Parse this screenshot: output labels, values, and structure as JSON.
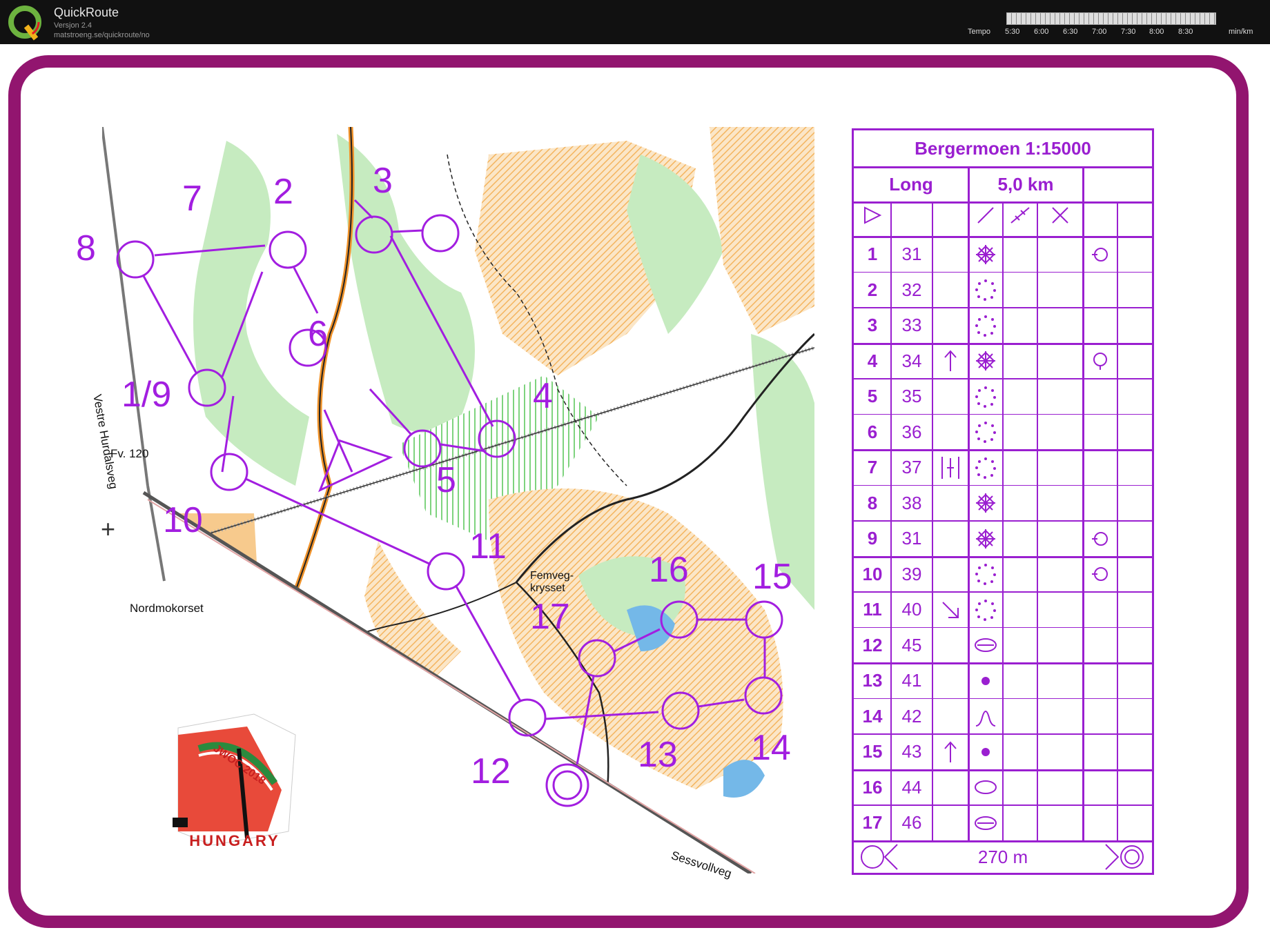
{
  "app": {
    "title": "QuickRoute",
    "version": "Versjon 2.4",
    "url": "matstroeng.se/quickroute/no"
  },
  "legend": {
    "label": "Tempo",
    "ticks": [
      "5:30",
      "6:00",
      "6:30",
      "7:00",
      "7:30",
      "8:00",
      "8:30"
    ],
    "unit": "min/km"
  },
  "map": {
    "place_labels": {
      "road1": "Vestre Hurdalsveg",
      "road2": "Fv. 120",
      "crossing": "Nordmokorset",
      "junction": "Femveg-\nkrysset",
      "road3": "Sessvollveg"
    },
    "control_labels": [
      "8",
      "7",
      "2",
      "3",
      "6",
      "1/9",
      "4",
      "5",
      "10",
      "11",
      "16",
      "15",
      "17",
      "12",
      "13",
      "14"
    ],
    "accent_color": "#a21ee0"
  },
  "description": {
    "title": "Bergermoen 1:15000",
    "class": "Long",
    "length": "5,0 km",
    "rows": [
      {
        "num": "1",
        "code": "31",
        "dir": "",
        "feature": "*",
        "extra": "o"
      },
      {
        "num": "2",
        "code": "32",
        "dir": "",
        "feature": ".",
        "extra": ""
      },
      {
        "num": "3",
        "code": "33",
        "dir": "",
        "feature": ".",
        "extra": ""
      },
      {
        "num": "4",
        "code": "34",
        "dir": "↑",
        "feature": "*",
        "extra": "o"
      },
      {
        "num": "5",
        "code": "35",
        "dir": "",
        "feature": ".",
        "extra": ""
      },
      {
        "num": "6",
        "code": "36",
        "dir": "",
        "feature": ".",
        "extra": ""
      },
      {
        "num": "7",
        "code": "37",
        "dir": "|",
        "feature": ".",
        "extra": ""
      },
      {
        "num": "8",
        "code": "38",
        "dir": "",
        "feature": "*",
        "extra": ""
      },
      {
        "num": "9",
        "code": "31",
        "dir": "",
        "feature": "*",
        "extra": "o"
      },
      {
        "num": "10",
        "code": "39",
        "dir": "",
        "feature": ".",
        "extra": "o"
      },
      {
        "num": "11",
        "code": "40",
        "dir": "↘",
        "feature": ".",
        "extra": ""
      },
      {
        "num": "12",
        "code": "45",
        "dir": "",
        "feature": "e",
        "extra": ""
      },
      {
        "num": "13",
        "code": "41",
        "dir": "",
        "feature": "•",
        "extra": ""
      },
      {
        "num": "14",
        "code": "42",
        "dir": "",
        "feature": "^",
        "extra": ""
      },
      {
        "num": "15",
        "code": "43",
        "dir": "↑",
        "feature": "•",
        "extra": ""
      },
      {
        "num": "16",
        "code": "44",
        "dir": "",
        "feature": "0",
        "extra": ""
      },
      {
        "num": "17",
        "code": "46",
        "dir": "",
        "feature": "e",
        "extra": ""
      }
    ],
    "finish": "270 m"
  },
  "logo": {
    "text": "HUNGARY",
    "event": "JWOC 2018"
  }
}
